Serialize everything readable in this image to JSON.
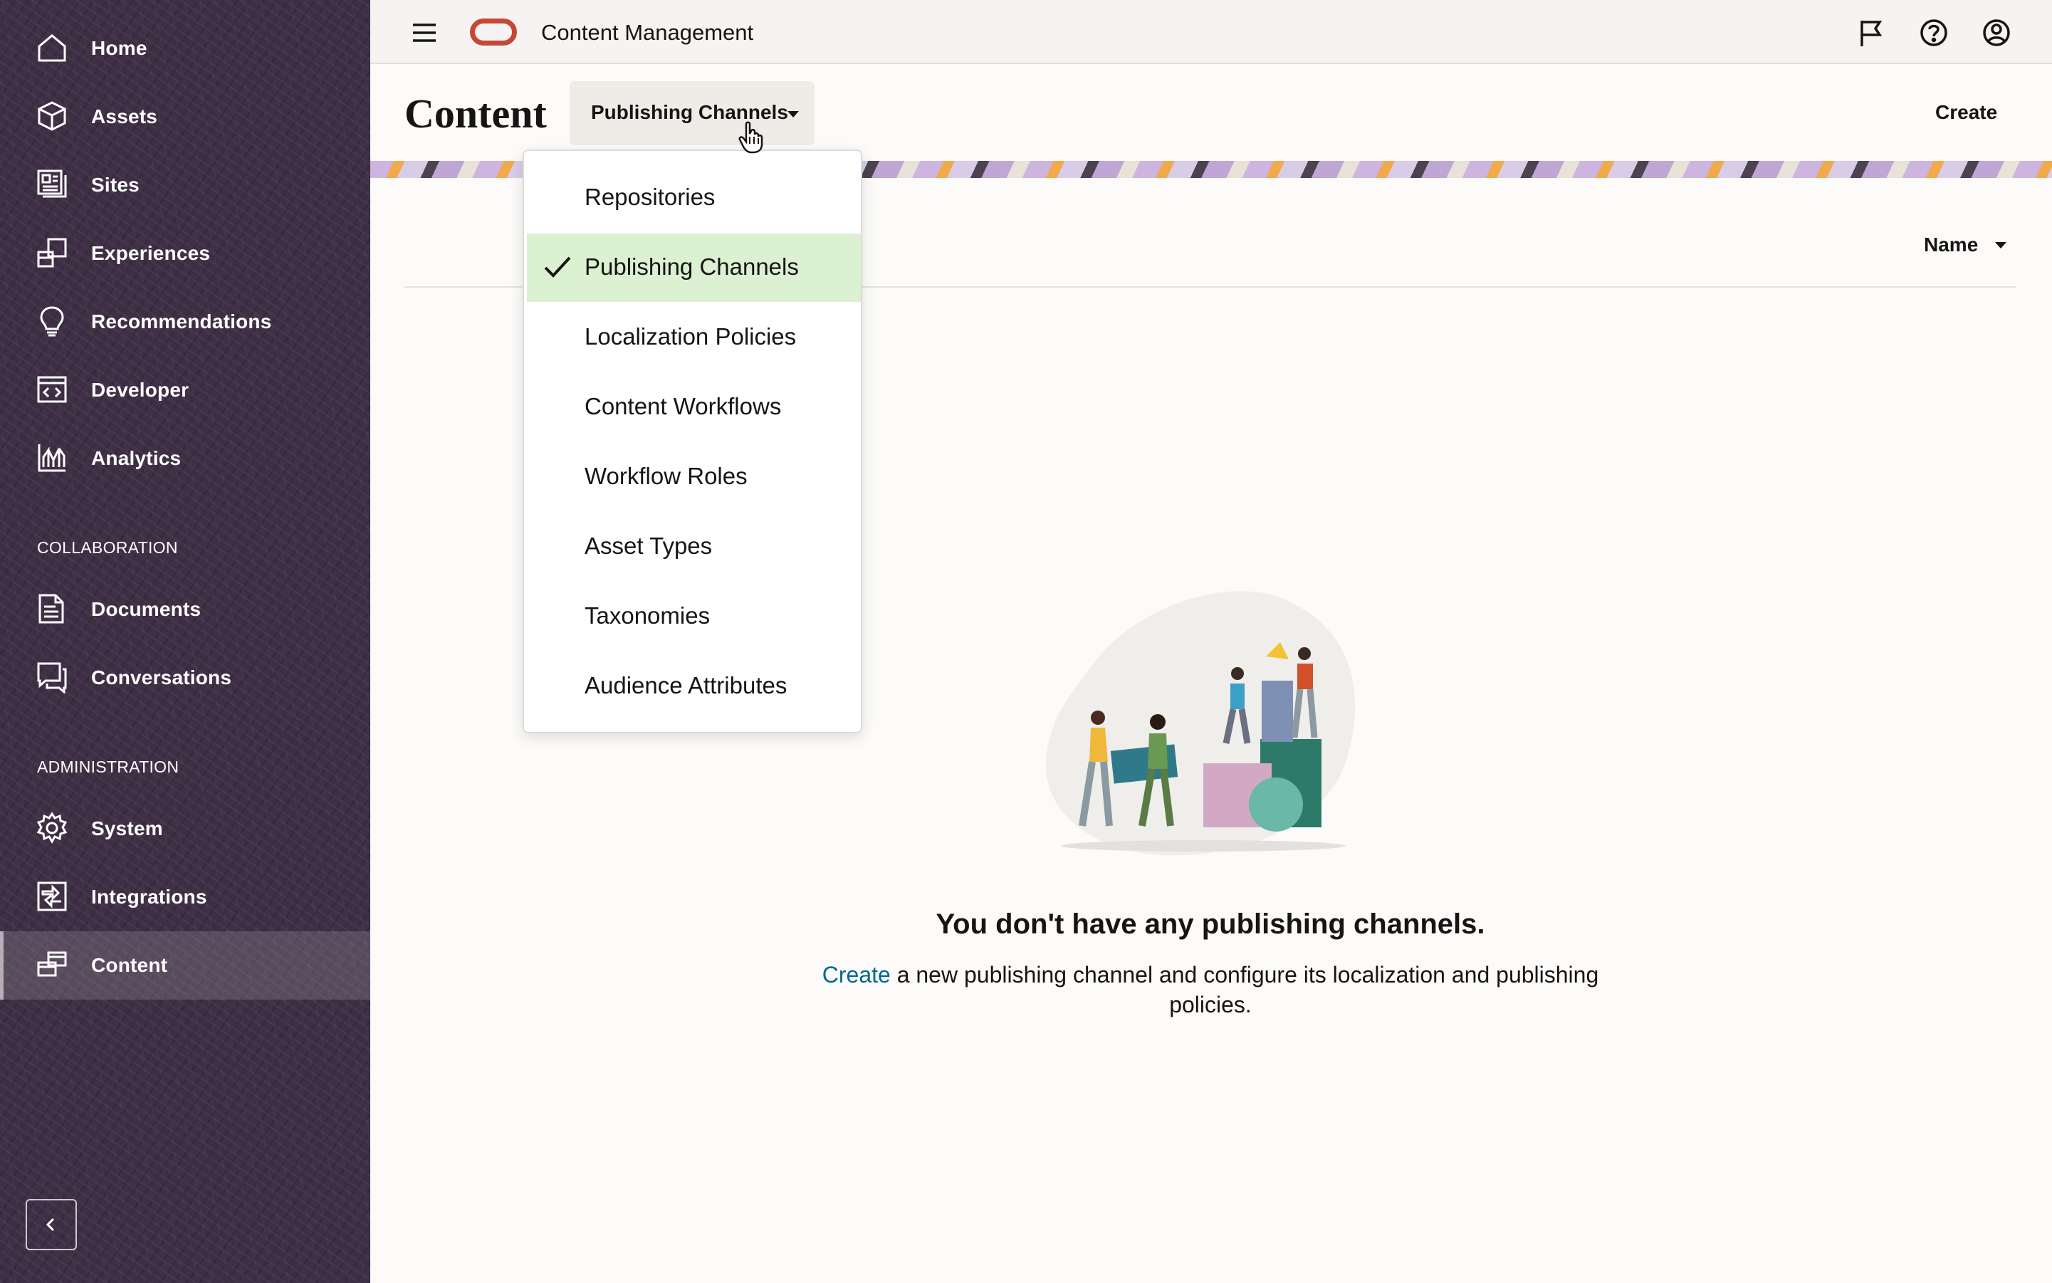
{
  "app": {
    "title": "Content Management"
  },
  "sidebar": {
    "items": [
      {
        "label": "Home",
        "icon": "home-icon"
      },
      {
        "label": "Assets",
        "icon": "cube-icon"
      },
      {
        "label": "Sites",
        "icon": "sites-icon"
      },
      {
        "label": "Experiences",
        "icon": "experiences-icon"
      },
      {
        "label": "Recommendations",
        "icon": "lightbulb-icon"
      },
      {
        "label": "Developer",
        "icon": "code-icon"
      },
      {
        "label": "Analytics",
        "icon": "chart-icon"
      }
    ],
    "collaboration": {
      "title": "COLLABORATION",
      "items": [
        {
          "label": "Documents",
          "icon": "document-icon"
        },
        {
          "label": "Conversations",
          "icon": "chat-icon"
        }
      ]
    },
    "administration": {
      "title": "ADMINISTRATION",
      "items": [
        {
          "label": "System",
          "icon": "gear-icon"
        },
        {
          "label": "Integrations",
          "icon": "integrations-icon"
        },
        {
          "label": "Content",
          "icon": "content-icon",
          "active": true
        }
      ]
    }
  },
  "header": {
    "page_title": "Content",
    "view_selector": "Publishing Channels",
    "create_label": "Create"
  },
  "toolbar": {
    "sort_label": "Name"
  },
  "dropdown": {
    "items": [
      {
        "label": "Repositories"
      },
      {
        "label": "Publishing Channels",
        "selected": true
      },
      {
        "label": "Localization Policies"
      },
      {
        "label": "Content Workflows"
      },
      {
        "label": "Workflow Roles"
      },
      {
        "label": "Asset Types"
      },
      {
        "label": "Taxonomies"
      },
      {
        "label": "Audience Attributes"
      }
    ]
  },
  "empty_state": {
    "heading": "You don't have any publishing channels.",
    "link_text": "Create",
    "body_text": " a new publishing channel and configure its localization and publishing policies."
  },
  "colors": {
    "sidebar_bg": "#3e2f45",
    "brand_red": "#c74634",
    "selected_bg": "#dcf0d2",
    "link": "#00688c"
  }
}
